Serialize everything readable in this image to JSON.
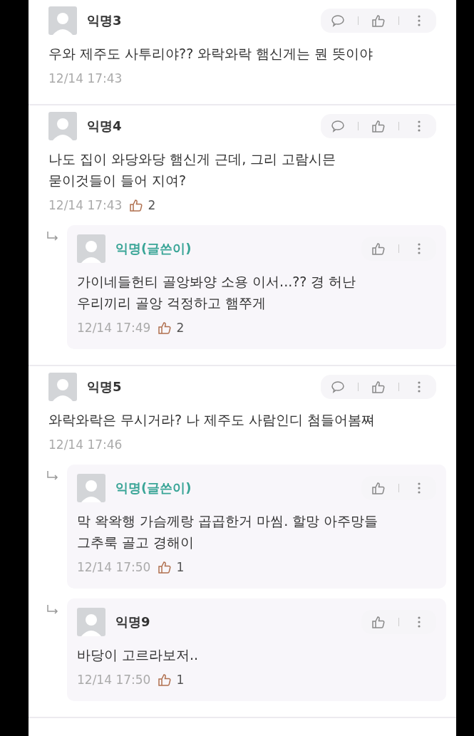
{
  "threads": [
    {
      "author": "익명3",
      "writer": false,
      "text": "우와 제주도 사투리야?? 와락와락 햄신게는 뭔 뜻이야",
      "time": "12/14 17:43"
    },
    {
      "author": "익명4",
      "writer": false,
      "text": "나도 집이 와당와당 햄신게 근데, 그리 고람시믄\n묻이것들이 들어 지여?",
      "time": "12/14 17:43",
      "likes": "2",
      "replies": [
        {
          "author": "익명(글쓴이)",
          "writer": true,
          "text": "가이네들헌티 골앙봐양 소용 이서...?? 경 허난\n우리끼리 골앙 걱정하고 햄쭈게",
          "time": "12/14 17:49",
          "likes": "2"
        }
      ]
    },
    {
      "author": "익명5",
      "writer": false,
      "text": "와락와락은 무시거라? 나 제주도 사람인디 첨들어봄쪄",
      "time": "12/14 17:46",
      "replies": [
        {
          "author": "익명(글쓴이)",
          "writer": true,
          "text": "막 왁왁행 가슴께랑 곱곱한거 마씸. 할망 아주망들\n그추룩 골고 경해이",
          "time": "12/14 17:50",
          "likes": "1"
        },
        {
          "author": "익명9",
          "writer": false,
          "text": "바당이 고르라보저..",
          "time": "12/14 17:50",
          "likes": "1"
        }
      ]
    }
  ]
}
